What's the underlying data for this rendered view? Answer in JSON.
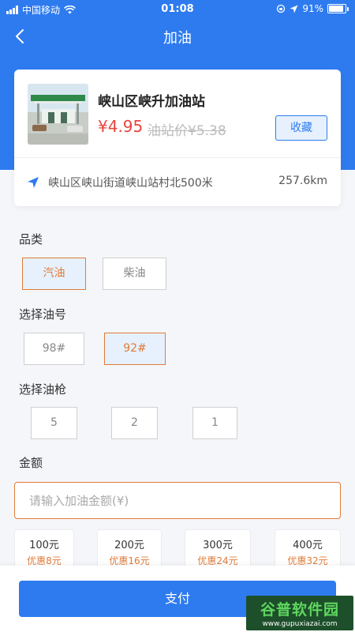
{
  "status_bar": {
    "carrier": "中国移动",
    "time": "01:08",
    "battery": "91%"
  },
  "nav": {
    "title": "加油"
  },
  "station": {
    "name": "峡山区峡升加油站",
    "price": "¥4.95",
    "original_price": "油站价¥5.38",
    "favorite_label": "收藏",
    "address": "峡山区峡山街道峡山站村北500米",
    "distance": "257.6km"
  },
  "category": {
    "label": "品类",
    "options": [
      "汽油",
      "柴油"
    ],
    "selected": "汽油"
  },
  "fuel_grade": {
    "label": "选择油号",
    "options": [
      "98#",
      "92#"
    ],
    "selected": "92#"
  },
  "nozzle": {
    "label": "选择油枪",
    "options": [
      "5",
      "2",
      "1"
    ]
  },
  "amount": {
    "label": "金额",
    "placeholder": "请输入加油金额(¥)",
    "presets": [
      {
        "value": "100元",
        "discount": "优惠8元"
      },
      {
        "value": "200元",
        "discount": "优惠16元"
      },
      {
        "value": "300元",
        "discount": "优惠24元"
      },
      {
        "value": "400元",
        "discount": "优惠32元"
      }
    ]
  },
  "pay_button_label": "支付",
  "watermark": {
    "title": "谷普软件园",
    "url": "www.gupuxiazai.com"
  },
  "colors": {
    "primary": "#2e7bf0",
    "accent": "#e07b39",
    "price_red": "#e8453c"
  }
}
